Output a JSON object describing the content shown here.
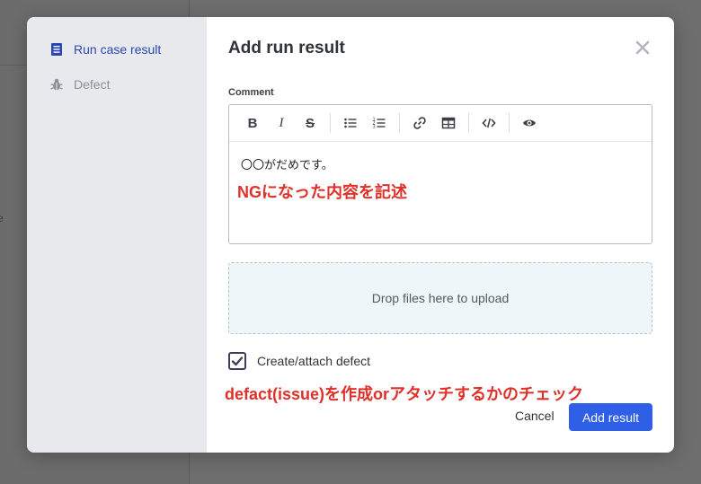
{
  "background": {
    "fragment_text": "e"
  },
  "sidebar": {
    "items": [
      {
        "label": "Run case result",
        "icon": "document-icon",
        "active": true
      },
      {
        "label": "Defect",
        "icon": "bug-icon",
        "active": false
      }
    ]
  },
  "dialog": {
    "title": "Add run result",
    "close_icon": "close-icon",
    "comment_label": "Comment",
    "toolbar": [
      "bold-icon",
      "italic-icon",
      "strikethrough-icon",
      "bullet-list-icon",
      "numbered-list-icon",
      "link-icon",
      "table-icon",
      "code-icon",
      "preview-eye-icon"
    ],
    "comment_text": "〇〇がだめです。",
    "dropzone_text": "Drop files here to upload",
    "checkbox": {
      "label": "Create/attach defect",
      "checked": true
    },
    "cancel_label": "Cancel",
    "submit_label": "Add result"
  },
  "annotations": {
    "note1": "NGになった内容を記述",
    "note2": "defact(issue)を作成orアタッチするかのチェック"
  },
  "colors": {
    "accent": "#2e5fe6",
    "sidebar_active": "#2b46b3",
    "annotation": "#e0302a"
  }
}
